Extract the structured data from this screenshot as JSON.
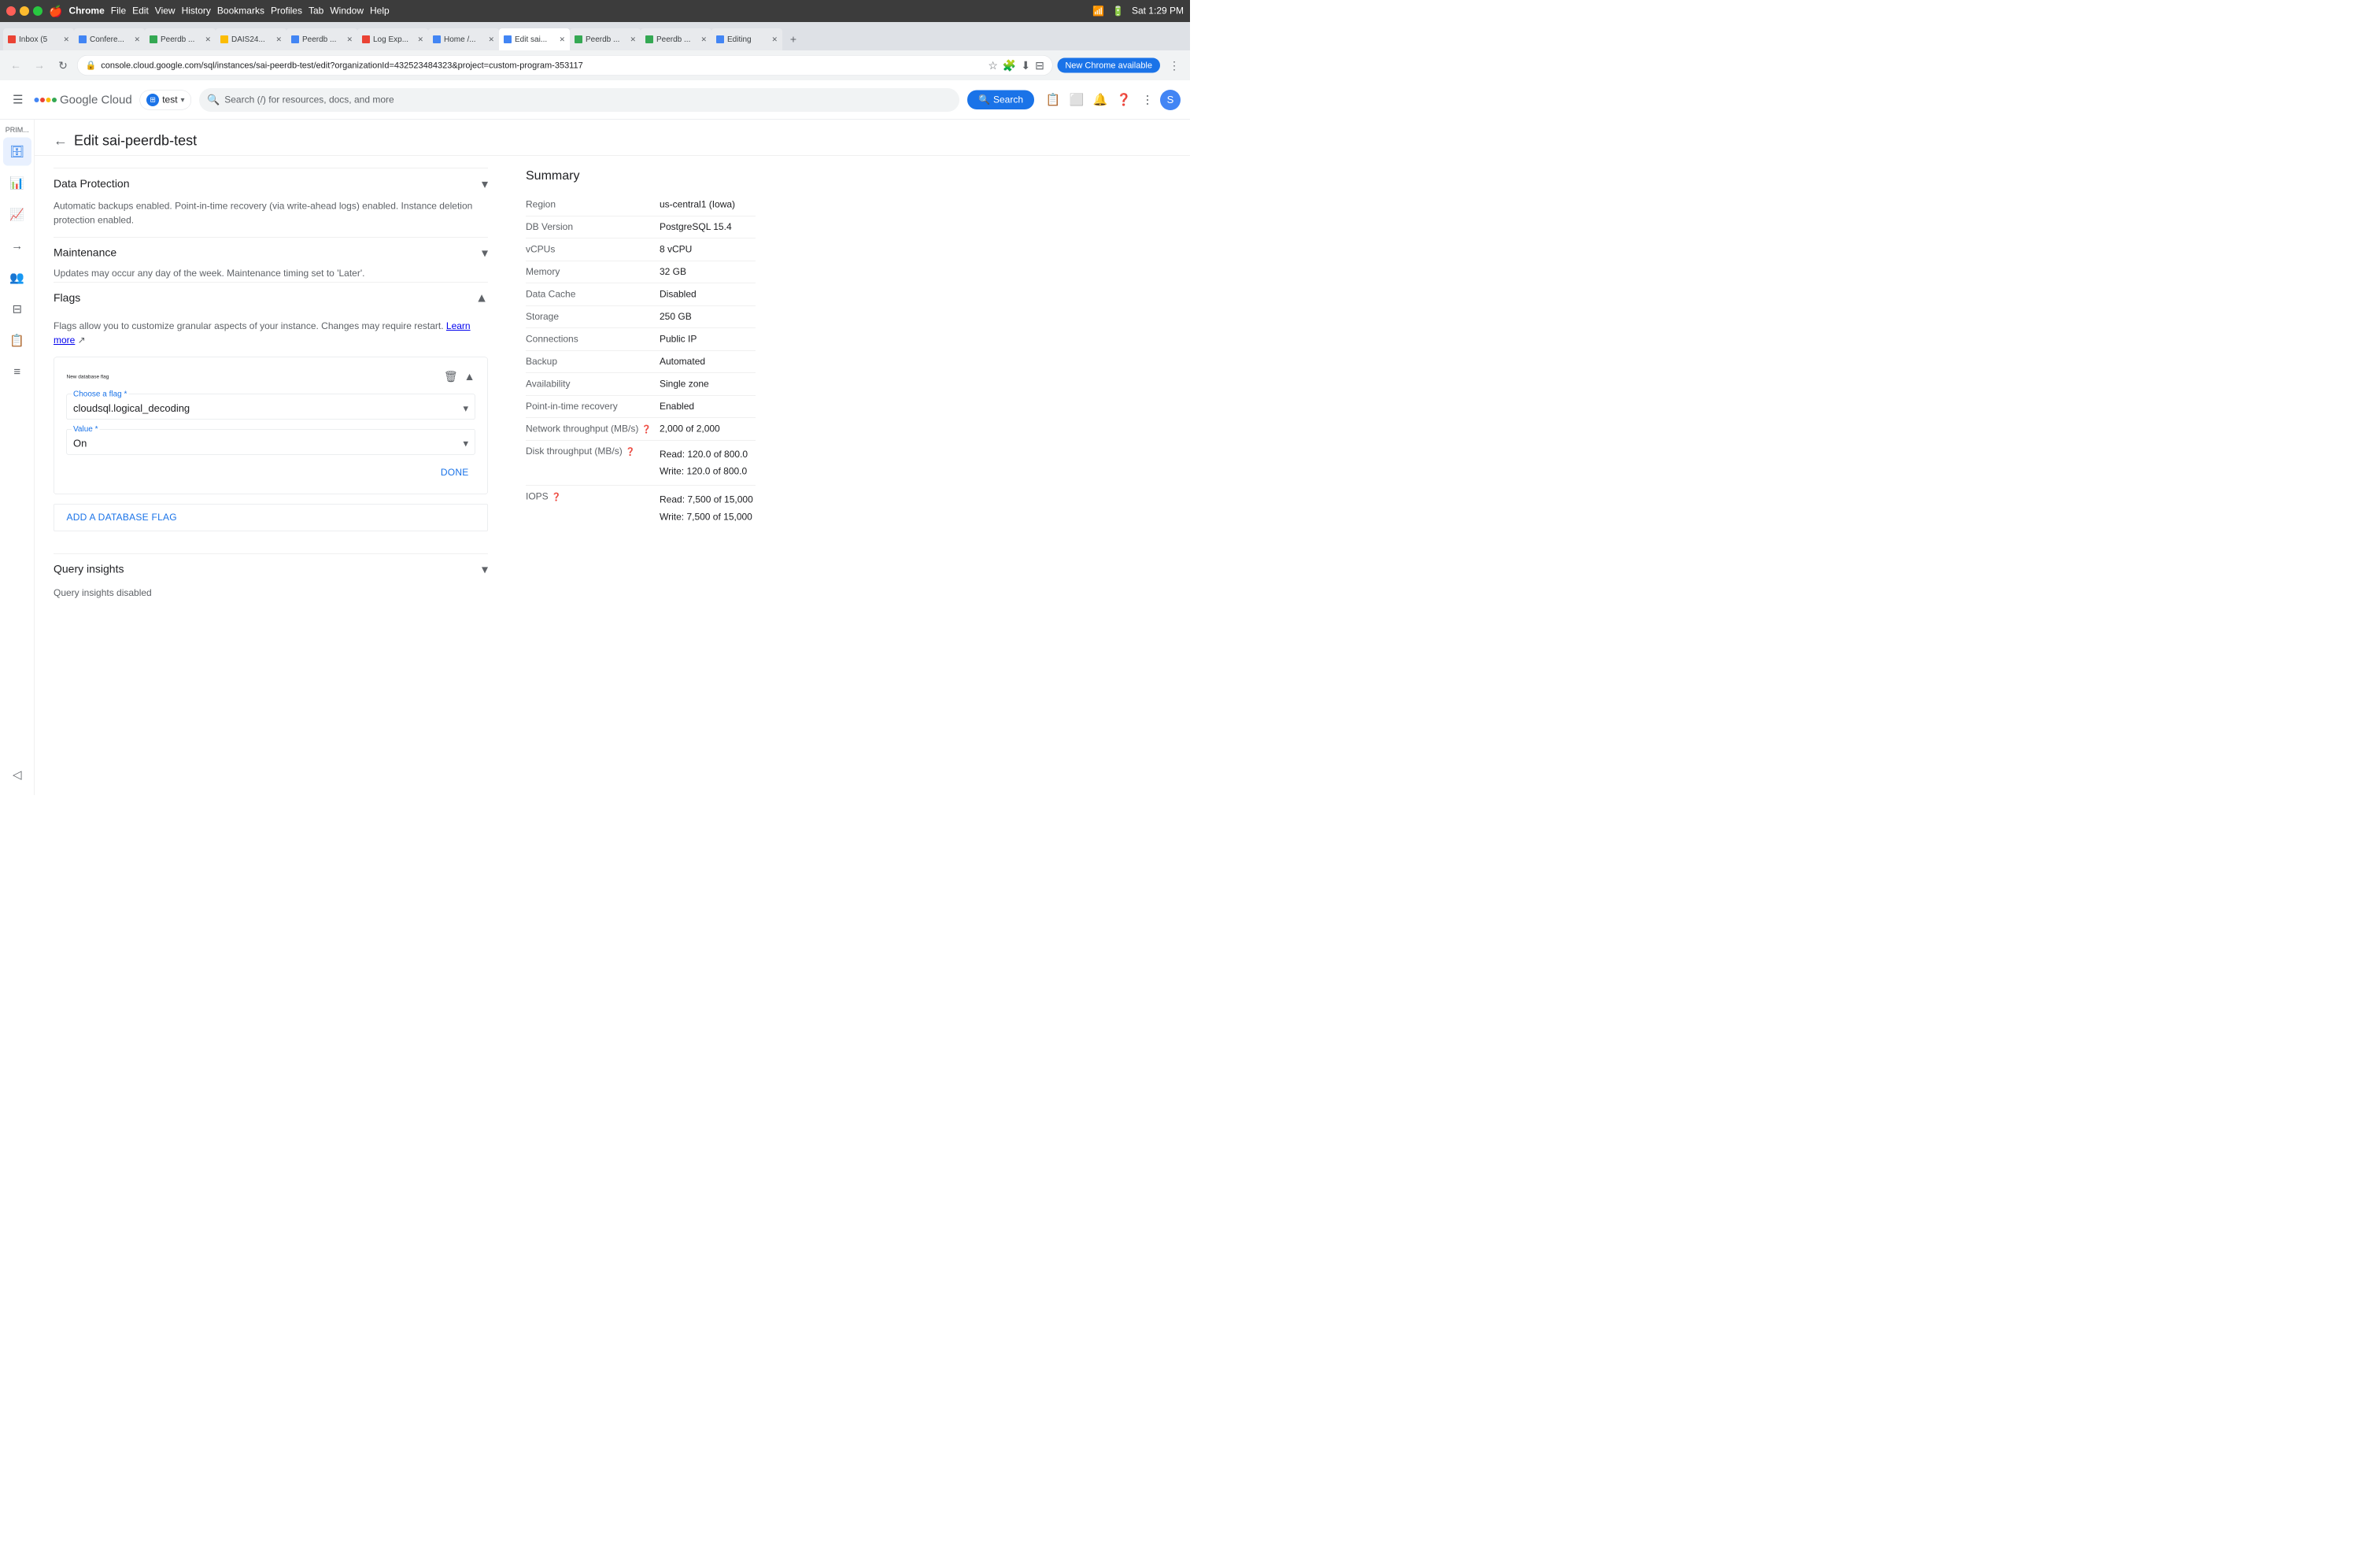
{
  "os": {
    "time": "Sat 1:29 PM",
    "app_name": "Chrome"
  },
  "chrome_update": "New Chrome available",
  "editing_tab_label": "Editing",
  "tabs": [
    {
      "id": "gmail",
      "label": "Inbox (5",
      "favicon_color": "#EA4335",
      "active": false
    },
    {
      "id": "conf",
      "label": "Confere...",
      "favicon_color": "#4285F4",
      "active": false
    },
    {
      "id": "peerdb1",
      "label": "Peerdb ...",
      "favicon_color": "#34A853",
      "active": false
    },
    {
      "id": "dais",
      "label": "DAIS24...",
      "favicon_color": "#FBBC05",
      "active": false
    },
    {
      "id": "peerdb2",
      "label": "Peerdb ...",
      "favicon_color": "#4285F4",
      "active": false
    },
    {
      "id": "logexp",
      "label": "Log Exp...",
      "favicon_color": "#EA4335",
      "active": false
    },
    {
      "id": "home",
      "label": "Home /...",
      "favicon_color": "#4285F4",
      "active": false
    },
    {
      "id": "editsai",
      "label": "Edit sai...",
      "favicon_color": "#4285F4",
      "active": true
    },
    {
      "id": "peerdb3",
      "label": "Peerdb ...",
      "favicon_color": "#34A853",
      "active": false
    },
    {
      "id": "peerdb4",
      "label": "Peerdb ...",
      "favicon_color": "#34A853",
      "active": false
    },
    {
      "id": "editing",
      "label": "Editing",
      "favicon_color": "#4285F4",
      "active": false
    }
  ],
  "url": "console.cloud.google.com/sql/instances/sai-peerdb-test/edit?organizationId=432523484323&project=custom-program-353117",
  "search_placeholder": "Search (/) for resources, docs, and more",
  "search_btn": "Search",
  "project": "test",
  "header": {
    "back_label": "←",
    "title": "Edit sai-peerdb-test"
  },
  "sidebar": {
    "prim_label": "PRIM...",
    "items": [
      {
        "id": "databases",
        "icon": "⊞",
        "label": "",
        "active": true
      },
      {
        "id": "monitoring",
        "icon": "📊",
        "label": ""
      },
      {
        "id": "analytics",
        "icon": "📈",
        "label": ""
      },
      {
        "id": "pipelines",
        "icon": "⇒",
        "label": ""
      },
      {
        "id": "users",
        "icon": "👥",
        "label": ""
      },
      {
        "id": "tables",
        "icon": "⊟",
        "label": ""
      },
      {
        "id": "reports",
        "icon": "📋",
        "label": ""
      },
      {
        "id": "logs",
        "icon": "≡",
        "label": ""
      },
      {
        "id": "settings",
        "icon": "⚙",
        "label": ""
      }
    ]
  },
  "sections": {
    "data_protection": {
      "title": "Data Protection",
      "description": "Automatic backups enabled. Point-in-time recovery (via write-ahead logs) enabled. Instance deletion protection enabled."
    },
    "maintenance": {
      "title": "Maintenance",
      "description": "Updates may occur any day of the week. Maintenance timing set to 'Later'."
    },
    "flags": {
      "title": "Flags",
      "description": "Flags allow you to customize granular aspects of your instance. Changes may require restart.",
      "learn_more": "Learn more",
      "new_flag": {
        "title": "New database flag",
        "choose_flag_label": "Choose a flag *",
        "flag_value": "cloudsql.logical_decoding",
        "value_label": "Value *",
        "value": "On",
        "done_btn": "DONE"
      },
      "add_btn": "ADD A DATABASE FLAG"
    },
    "query_insights": {
      "title": "Query insights",
      "description": "Query insights disabled"
    }
  },
  "summary": {
    "title": "Summary",
    "rows": [
      {
        "key": "Region",
        "value": "us-central1 (Iowa)",
        "has_help": false
      },
      {
        "key": "DB Version",
        "value": "PostgreSQL 15.4",
        "has_help": false
      },
      {
        "key": "vCPUs",
        "value": "8 vCPU",
        "has_help": false
      },
      {
        "key": "Memory",
        "value": "32 GB",
        "has_help": false
      },
      {
        "key": "Data Cache",
        "value": "Disabled",
        "has_help": false
      },
      {
        "key": "Storage",
        "value": "250 GB",
        "has_help": false
      },
      {
        "key": "Connections",
        "value": "Public IP",
        "has_help": false
      },
      {
        "key": "Backup",
        "value": "Automated",
        "has_help": false
      },
      {
        "key": "Availability",
        "value": "Single zone",
        "has_help": false
      },
      {
        "key": "Point-in-time recovery",
        "value": "Enabled",
        "has_help": false
      },
      {
        "key": "Network throughput (MB/s)",
        "value": "2,000 of 2,000",
        "has_help": true
      },
      {
        "key": "Disk throughput (MB/s)",
        "value": "Read: 120.0 of 800.0\nWrite: 120.0 of 800.0",
        "has_help": true
      },
      {
        "key": "IOPS",
        "value": "Read: 7,500 of 15,000\nWrite: 7,500 of 15,000",
        "has_help": true
      }
    ]
  }
}
